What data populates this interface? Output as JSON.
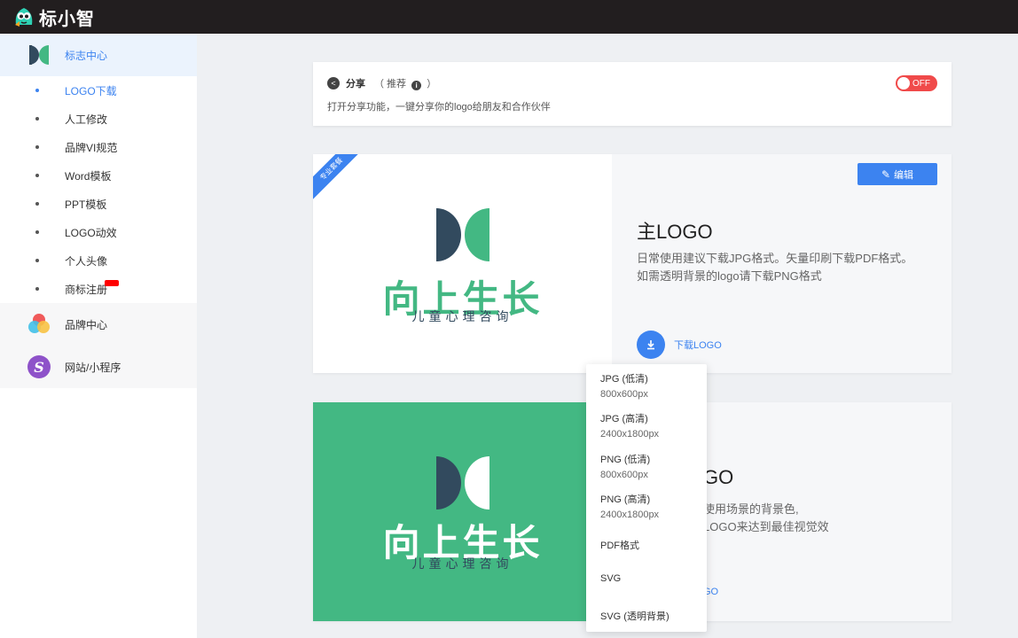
{
  "app": {
    "name": "标小智"
  },
  "sidebar": {
    "groups": [
      {
        "label": "标志中心",
        "icon": "logo-center-icon"
      },
      {
        "label": "品牌中心",
        "icon": "brand-center-icon"
      },
      {
        "label": "网站/小程序",
        "icon": "website-icon"
      }
    ],
    "items": [
      {
        "label": "LOGO下载"
      },
      {
        "label": "人工修改"
      },
      {
        "label": "品牌VI规范"
      },
      {
        "label": "Word模板"
      },
      {
        "label": "PPT模板"
      },
      {
        "label": "LOGO动效"
      },
      {
        "label": "个人头像"
      },
      {
        "label": "商标注册"
      }
    ]
  },
  "share": {
    "title": "分享",
    "recommend_open": "（ 推荐",
    "recommend_close": "）",
    "description": "打开分享功能，一键分享你的logo给朋友和合作伙伴",
    "toggle_label": "OFF"
  },
  "logo": {
    "name": "向上生长",
    "subtitle": "儿童心理咨询"
  },
  "card1": {
    "ribbon": "专业套餐",
    "edit_label": "编辑",
    "title": "主LOGO",
    "desc_line1": "日常使用建议下载JPG格式。矢量印刷下载PDF格式。",
    "desc_line2": "如需透明背景的logo请下载PNG格式",
    "download_label": "下载LOGO"
  },
  "card2": {
    "title_visible": "GO",
    "desc_line1": "使用场景的背景色,",
    "desc_line2": "LOGO来达到最佳视觉效",
    "download_visible": "GO"
  },
  "dropdown": {
    "options": [
      {
        "label": "JPG (低清)",
        "size": "800x600px"
      },
      {
        "label": "JPG (高清)",
        "size": "2400x1800px"
      },
      {
        "label": "PNG (低清)",
        "size": "800x600px"
      },
      {
        "label": "PNG (高清)",
        "size": "2400x1800px"
      },
      {
        "label": "PDF格式",
        "size": ""
      },
      {
        "label": "SVG",
        "size": ""
      },
      {
        "label": "SVG (透明背景)",
        "size": ""
      }
    ]
  },
  "colors": {
    "brand_green": "#43b883",
    "brand_navy": "#324a5e",
    "accent_blue": "#3c83f0",
    "toggle_red": "#f04a4a"
  }
}
